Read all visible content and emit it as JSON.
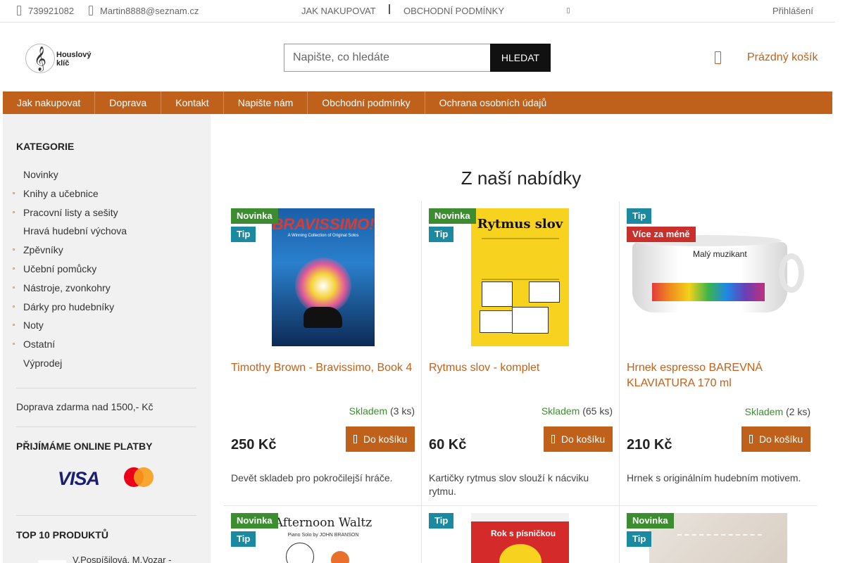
{
  "topbar": {
    "phone": "739921082",
    "email": "Martin8888@seznam.cz",
    "link_how": "JAK NAKUPOVAT",
    "link_terms": "OBCHODNÍ PODMÍNKY",
    "login": "Přihlášení"
  },
  "header": {
    "logo_text": "Houslový klíč",
    "search_placeholder": "Napište, co hledáte",
    "search_button": "HLEDAT",
    "cart_label": "Prázdný košík"
  },
  "nav": [
    "Jak nakupovat",
    "Doprava",
    "Kontakt",
    "Napište nám",
    "Obchodní podmínky",
    "Ochrana osobních údajů"
  ],
  "sidebar": {
    "categories_title": "KATEGORIE",
    "categories": [
      {
        "label": "Novinky",
        "bullet": false
      },
      {
        "label": "Knihy a učebnice",
        "bullet": true
      },
      {
        "label": "Pracovní listy a sešity",
        "bullet": true
      },
      {
        "label": "Hravá hudební výchova",
        "bullet": false
      },
      {
        "label": "Zpěvníky",
        "bullet": true
      },
      {
        "label": "Učební pomůcky",
        "bullet": true
      },
      {
        "label": "Nástroje, zvonkohry",
        "bullet": true
      },
      {
        "label": "Dárky pro hudebníky",
        "bullet": true
      },
      {
        "label": "Noty",
        "bullet": true
      },
      {
        "label": "Ostatní",
        "bullet": true
      },
      {
        "label": "Výprodej",
        "bullet": false
      }
    ],
    "shipping_note": "Doprava zdarma nad 1500,- Kč",
    "payments_title": "PŘIJÍMÁME ONLINE PLATBY",
    "visa": "VISA",
    "top_title": "TOP 10 PRODUKTŮ",
    "top_first": "V.Pospíšilová, M.Vozar -"
  },
  "main": {
    "section_title": "Z naší nabídky",
    "buy_label": "Do košíku",
    "products": [
      {
        "badges": [
          "Novinka",
          "Tip"
        ],
        "name": "Timothy Brown - Bravissimo, Book 4",
        "image_title": "BRAVISSIMO!",
        "image_sub": "A Winning Collection of Original Solos",
        "stock": "Skladem",
        "qty": "(3 ks)",
        "price": "250 Kč",
        "desc": "Devět skladeb pro pokročilejší hráče."
      },
      {
        "badges": [
          "Novinka",
          "Tip"
        ],
        "name": "Rytmus slov - komplet",
        "image_title": "Rytmus slov",
        "stock": "Skladem",
        "qty": "(65 ks)",
        "price": "60 Kč",
        "desc": "Kartičky rytmus slov slouží k nácviku rytmu."
      },
      {
        "badges": [
          "Tip",
          "Více za méně"
        ],
        "name": "Hrnek espresso BAREVNÁ KLAVIATURA 170 ml",
        "image_title": "Malý muzikant",
        "stock": "Skladem",
        "qty": "(2 ks)",
        "price": "210 Kč",
        "desc": "Hrnek s originálním hudebním motivem."
      }
    ],
    "row2": [
      {
        "badges": [
          "Novinka",
          "Tip"
        ],
        "image_title": "Afternoon Waltz",
        "image_sub": "Piano Solo by JOHN BRANSON"
      },
      {
        "badges": [
          "Tip"
        ],
        "image_title": "Rok s písničkou"
      },
      {
        "badges": [
          "Novinka",
          "Tip"
        ],
        "image_title": ""
      }
    ]
  }
}
